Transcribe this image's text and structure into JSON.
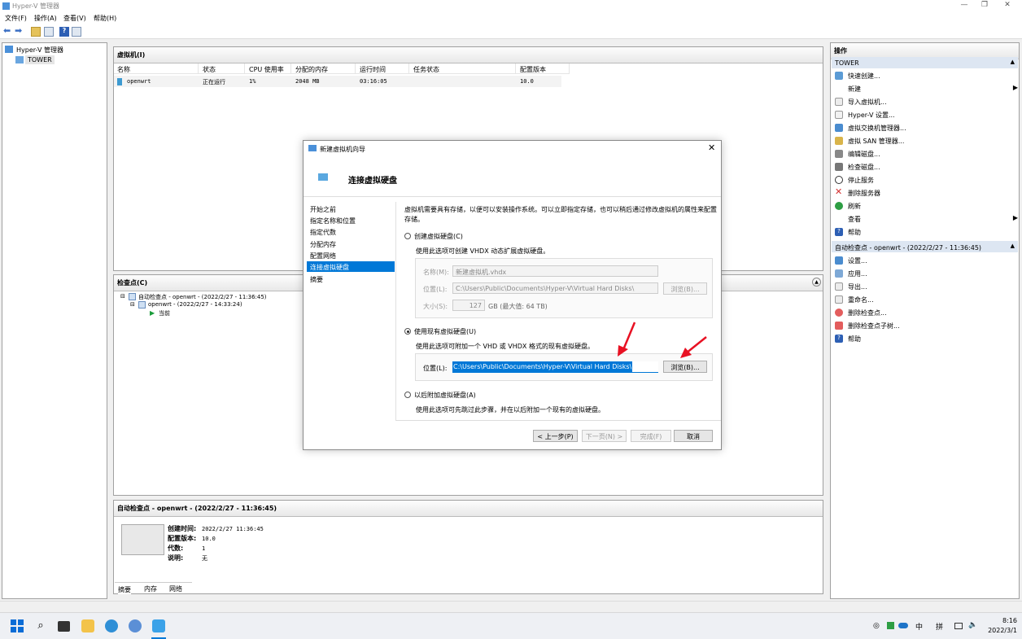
{
  "window": {
    "title": "Hyper-V 管理器"
  },
  "menu": [
    "文件(F)",
    "操作(A)",
    "查看(V)",
    "帮助(H)"
  ],
  "tree": {
    "root": "Hyper-V 管理器",
    "server": "TOWER"
  },
  "vms": {
    "header": "虚拟机(I)",
    "columns": [
      "名称",
      "状态",
      "CPU 使用率",
      "分配的内存",
      "运行时间",
      "任务状态",
      "配置版本"
    ],
    "rows": [
      {
        "name": "openwrt",
        "state": "正在运行",
        "cpu": "1%",
        "mem": "2048 MB",
        "uptime": "03:16:05",
        "task": "",
        "version": "10.0"
      }
    ]
  },
  "checkpoints": {
    "header": "检查点(C)",
    "items": [
      "自动检查点 - openwrt - (2022/2/27 - 11:36:45)",
      "openwrt - (2022/2/27 - 14:33:24)",
      "当前"
    ]
  },
  "details": {
    "header": "自动检查点 - openwrt - (2022/2/27 - 11:36:45)",
    "fields": [
      {
        "k": "创建时间:",
        "v": "2022/2/27 11:36:45"
      },
      {
        "k": "配置版本:",
        "v": "10.0"
      },
      {
        "k": "代数:",
        "v": "1"
      },
      {
        "k": "说明:",
        "v": "无"
      }
    ],
    "tabs": [
      "摘要",
      "内存",
      "网络"
    ]
  },
  "actions": {
    "header": "操作",
    "section1": "TOWER",
    "items1": [
      "快速创建...",
      "新建",
      "导入虚拟机...",
      "Hyper-V 设置...",
      "虚拟交换机管理器...",
      "虚拟 SAN 管理器...",
      "编辑磁盘...",
      "检查磁盘...",
      "停止服务",
      "删除服务器",
      "刷新",
      "查看",
      "帮助"
    ],
    "section2": "自动检查点 - openwrt - (2022/2/27 - 11:36:45)",
    "items2": [
      "设置...",
      "应用...",
      "导出...",
      "重命名...",
      "删除检查点...",
      "删除检查点子树...",
      "帮助"
    ]
  },
  "wizard": {
    "title": "新建虚拟机向导",
    "heading": "连接虚拟硬盘",
    "nav": [
      "开始之前",
      "指定名称和位置",
      "指定代数",
      "分配内存",
      "配置网络",
      "连接虚拟硬盘",
      "摘要"
    ],
    "selected_nav": 5,
    "intro": "虚拟机需要具有存储，以便可以安装操作系统。可以立即指定存储，也可以稍后通过修改虚拟机的属性来配置存储。",
    "opt1": {
      "label": "创建虚拟硬盘(C)",
      "desc": "使用此选项可创建 VHDX 动态扩展虚拟硬盘。",
      "name_label": "名称(M):",
      "name_value": "新建虚拟机.vhdx",
      "loc_label": "位置(L):",
      "loc_value": "C:\\Users\\Public\\Documents\\Hyper-V\\Virtual Hard Disks\\",
      "browse": "浏览(B)...",
      "size_label": "大小(S):",
      "size_value": "127",
      "size_unit": "GB (最大值: 64 TB)"
    },
    "opt2": {
      "label": "使用现有虚拟硬盘(U)",
      "desc": "使用此选项可附加一个 VHD 或 VHDX 格式的现有虚拟硬盘。",
      "loc_label": "位置(L):",
      "loc_value": "C:\\Users\\Public\\Documents\\Hyper-V\\Virtual Hard Disks\\",
      "browse": "浏览(B)..."
    },
    "opt3": {
      "label": "以后附加虚拟硬盘(A)",
      "desc": "使用此选项可先跳过此步骤，并在以后附加一个现有的虚拟硬盘。"
    },
    "buttons": {
      "prev": "< 上一步(P)",
      "next": "下一页(N) >",
      "finish": "完成(F)",
      "cancel": "取消"
    }
  },
  "tray": {
    "ime1": "中",
    "ime2": "拼",
    "time": "8:16",
    "date": "2022/3/1"
  },
  "colors": {
    "accent": "#0078d7",
    "arrow": "#e81123"
  }
}
